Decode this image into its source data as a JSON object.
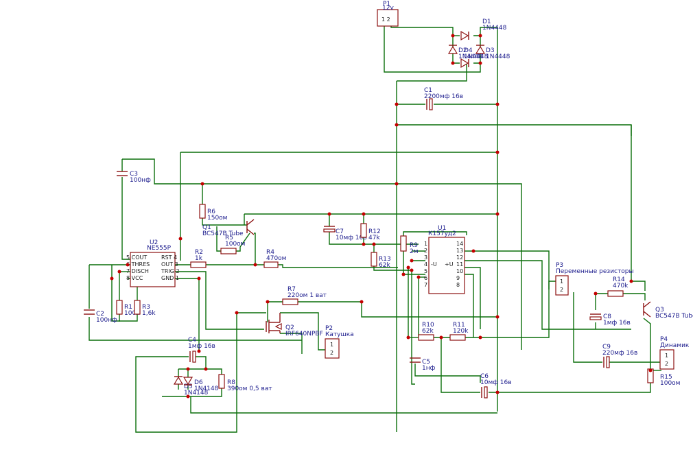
{
  "labels": {
    "p1_name": "P1",
    "p1_val": "12v",
    "p1_pins": "1  2",
    "d1_name": "D1",
    "d1_val": "1N4448",
    "d2_name": "D2",
    "d2_val": "1N4448",
    "d3_name": "D3",
    "d3_val": "1N4448",
    "d4_name": "D4",
    "d4_val": "1N4448",
    "c1_name": "C1",
    "c1_val": "2200мф 16в",
    "c3_name": "C3",
    "c3_val": "100нф",
    "u2_name": "U2",
    "u2_val": "NE555P",
    "r6_name": "R6",
    "r6_val": "150ом",
    "q1_name": "Q1",
    "q1_val": "BC547B Tube",
    "r5_name": "R5",
    "r5_val": "100ом",
    "r2_name": "R2",
    "r2_val": "1k",
    "r4_name": "R4",
    "r4_val": "470ом",
    "c7_name": "C7",
    "c7_val": "10мф 16в",
    "r12_name": "R12",
    "r12_val": "47k",
    "r13_name": "R13",
    "r13_val": "62k",
    "r9_name": "R9",
    "r9_val": "2м",
    "u1_name": "U1",
    "u1_val": "К157уд2",
    "p3_name": "P3",
    "p3_val": "Переменные резисторы",
    "r14_name": "R14",
    "r14_val": "470k",
    "q3_name": "Q3",
    "q3_val": "BC547B Tube",
    "c8_name": "C8",
    "c8_val": "1мф 16в",
    "r1_name": "R1",
    "r1_val": "100k",
    "r3_name": "R3",
    "r3_val": "1,6k",
    "c2_name": "C2",
    "c2_val": "100нф",
    "r7_name": "R7",
    "r7_val": "220ом 1 ват",
    "q2_name": "Q2",
    "q2_val": "IRF640NPBF",
    "p2_name": "P2",
    "p2_val": "Катушка",
    "r10_name": "R10",
    "r10_val": "62k",
    "r11_name": "R11",
    "r11_val": "120k",
    "c9_name": "C9",
    "c9_val": "220мф 16в",
    "p4_name": "P4",
    "p4_val": "Динамик",
    "c4_name": "C4",
    "c4_val": "1мф 16в",
    "d5_name": "D5",
    "d5_val": "1N4148",
    "d6_name": "D6",
    "d6_val": "1N4148",
    "r8_name": "R8",
    "r8_val": "390ом 0,5 ват",
    "c5_name": "C5",
    "c5_val": "1нф",
    "c6_name": "C6",
    "c6_val": "10мф 16в",
    "r15_name": "R15",
    "r15_val": "100ом"
  },
  "ne555_pins": {
    "left": [
      "5 COUT",
      "6 THRES",
      "7 DISCH",
      "8 VCC"
    ],
    "right": [
      "RST 4",
      "OUT 3",
      "TRIG 2",
      "GND 1"
    ]
  },
  "k157_pins": {
    "left": [
      "1",
      "2",
      "3",
      "4",
      "5",
      "6",
      "7"
    ],
    "left_fn": [
      "",
      "",
      "",
      "-U",
      "",
      "",
      ""
    ],
    "right": [
      "14",
      "13",
      "12",
      "11",
      "10",
      "9",
      "8"
    ],
    "right_fn": [
      "",
      "",
      "",
      "+U",
      "",
      "",
      ""
    ]
  },
  "connector_pins": [
    "1",
    "2"
  ]
}
